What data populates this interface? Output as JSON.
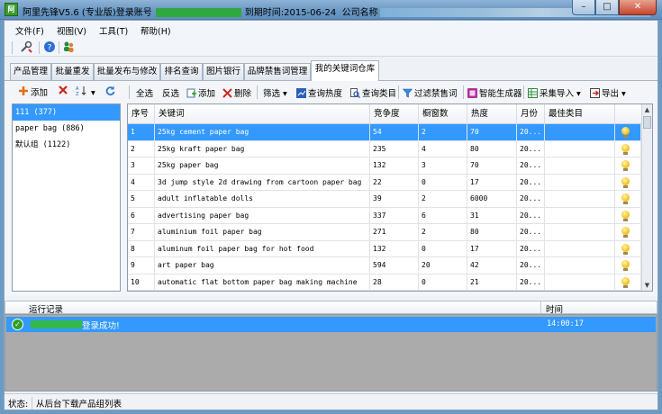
{
  "window": {
    "title_part1": "阿里先锋V5.6 (专业版)登录账号",
    "title_part2": "到期时间:2015-06-24",
    "title_part3": "公司名称"
  },
  "menu": [
    "文件(F)",
    "视图(V)",
    "工具(T)",
    "帮助(H)"
  ],
  "tabs": [
    "产品管理",
    "批量重发",
    "批量发布与修改",
    "排名查询",
    "图片银行",
    "品牌禁售词管理",
    "我的关键词仓库"
  ],
  "left_toolbar": {
    "add_label": "添加"
  },
  "groups": [
    {
      "label": "111 (377)",
      "selected": true
    },
    {
      "label": "paper bag (886)",
      "selected": false
    },
    {
      "label": "默认组 (1122)",
      "selected": false
    }
  ],
  "right_toolbar": {
    "select_all": "全选",
    "invert": "反选",
    "add": "添加",
    "delete": "删除",
    "filter": "筛选",
    "query_heat": "查询热度",
    "query_category": "查询类目",
    "filter_banned": "过滤禁售词",
    "smart_generator": "智能生成器",
    "collect_import": "采集导入",
    "export": "导出"
  },
  "grid": {
    "headers": [
      "序号",
      "关键词",
      "竞争度",
      "橱窗数",
      "热度",
      "月份",
      "最佳类目"
    ],
    "rows": [
      {
        "no": "1",
        "keyword": "25kg cement paper bag",
        "competition": "54",
        "showcase": "2",
        "heat": "70",
        "month": "20...",
        "selected": true
      },
      {
        "no": "2",
        "keyword": "25kg kraft paper bag",
        "competition": "235",
        "showcase": "4",
        "heat": "80",
        "month": "20...",
        "selected": false
      },
      {
        "no": "3",
        "keyword": "25kg paper bag",
        "competition": "132",
        "showcase": "3",
        "heat": "70",
        "month": "20...",
        "selected": false
      },
      {
        "no": "4",
        "keyword": "3d jump style 2d drawing from cartoon paper bag",
        "competition": "22",
        "showcase": "0",
        "heat": "17",
        "month": "20...",
        "selected": false
      },
      {
        "no": "5",
        "keyword": "adult inflatable dolls",
        "competition": "39",
        "showcase": "2",
        "heat": "6000",
        "month": "20...",
        "selected": false
      },
      {
        "no": "6",
        "keyword": "advertising paper bag",
        "competition": "337",
        "showcase": "6",
        "heat": "31",
        "month": "20...",
        "selected": false
      },
      {
        "no": "7",
        "keyword": "aluminium foil paper bag",
        "competition": "271",
        "showcase": "2",
        "heat": "80",
        "month": "20...",
        "selected": false
      },
      {
        "no": "8",
        "keyword": "aluminum foil paper bag for hot food",
        "competition": "132",
        "showcase": "0",
        "heat": "17",
        "month": "20...",
        "selected": false
      },
      {
        "no": "9",
        "keyword": "art paper bag",
        "competition": "594",
        "showcase": "20",
        "heat": "42",
        "month": "20...",
        "selected": false
      },
      {
        "no": "10",
        "keyword": "automatic flat bottom paper bag making machine",
        "competition": "28",
        "showcase": "0",
        "heat": "21",
        "month": "20...",
        "selected": false
      }
    ]
  },
  "log": {
    "header_record": "运行记录",
    "header_time": "时间",
    "entries": [
      {
        "message": "登录成功!",
        "time": "14:00:17"
      }
    ]
  },
  "status": {
    "label": "状态:",
    "text": "从后台下载产品组列表"
  },
  "colors": {
    "selection": "#3399ff",
    "accent": "#2fa840"
  }
}
